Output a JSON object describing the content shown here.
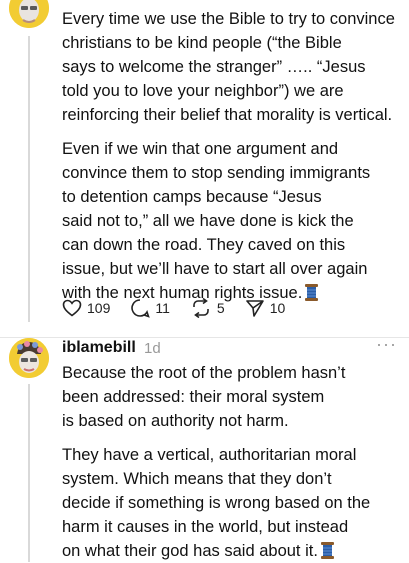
{
  "post1": {
    "paragraphs": [
      "Every time we use the Bible to try to convince\nchristians to be kind people (“the Bible\nsays to welcome the stranger” ….. “Jesus\ntold you to love your neighbor”) we are\nreinforcing their belief that morality is vertical.",
      "Even if we win that one argument and\nconvince them to stop sending immigrants\nto detention camps because “Jesus\nsaid not to,” all we have done is kick the\ncan down the road. They caved on this\nissue, but we’ll have to start all over again\nwith the next human rights issue."
    ],
    "likes": "109",
    "replies": "11",
    "reposts": "5",
    "shares": "10"
  },
  "post2": {
    "username": "iblamebill",
    "timestamp": "1d",
    "more": "···",
    "paragraphs": [
      "Because the root of the problem hasn’t\nbeen addressed: their moral system\nis based on authority not harm.",
      "They have a vertical, authoritarian moral\nsystem. Which means that they don’t\ndecide if something is wrong based on the\nharm it causes in the world, but instead\non what their god has said about it."
    ]
  },
  "colors": {
    "avatar_bg": "#f2cc33",
    "spool_blue": "#2b5ea7",
    "muted": "#999999"
  },
  "icons": [
    "avatar",
    "spool-of-thread-emoji",
    "heart-icon",
    "reply-icon",
    "repost-icon",
    "share-icon",
    "more-icon"
  ]
}
